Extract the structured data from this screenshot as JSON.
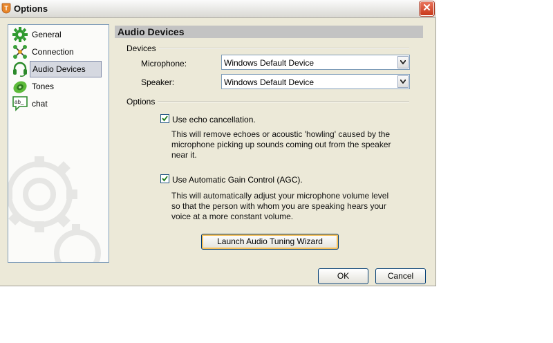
{
  "window": {
    "title": "Options",
    "close_glyph": "✕"
  },
  "sidebar": {
    "items": [
      {
        "label": "General",
        "icon": "gear-icon"
      },
      {
        "label": "Connection",
        "icon": "connection-icon"
      },
      {
        "label": "Audio Devices",
        "icon": "headset-icon",
        "selected": true
      },
      {
        "label": "Tones",
        "icon": "speaker-icon"
      },
      {
        "label": "chat",
        "icon": "chat-bubble-icon",
        "icon_text": "ab_"
      }
    ]
  },
  "panel": {
    "title": "Audio Devices",
    "devices": {
      "group_label": "Devices",
      "microphone_label": "Microphone:",
      "microphone_value": "Windows Default Device",
      "speaker_label": "Speaker:",
      "speaker_value": "Windows Default Device"
    },
    "options": {
      "group_label": "Options",
      "echo": {
        "label": "Use echo cancellation.",
        "checked": true,
        "desc": [
          "This will remove echoes or acoustic 'howling' caused by the",
          "microphone picking up sounds coming out from the speaker",
          "near it."
        ]
      },
      "agc": {
        "label": "Use Automatic Gain Control (AGC).",
        "checked": true,
        "desc": [
          "This will automatically adjust your microphone volume level",
          "so that the person with whom you are speaking hears your",
          "voice at a more constant volume."
        ]
      }
    },
    "wizard_button": "Launch Audio Tuning Wizard"
  },
  "footer": {
    "ok_label": "OK",
    "cancel_label": "Cancel"
  },
  "colors": {
    "window_bg": "#ece9d8",
    "header_band": "#c3c3c3",
    "selection": "#d5d8e0",
    "close_red": "#c8391b"
  }
}
